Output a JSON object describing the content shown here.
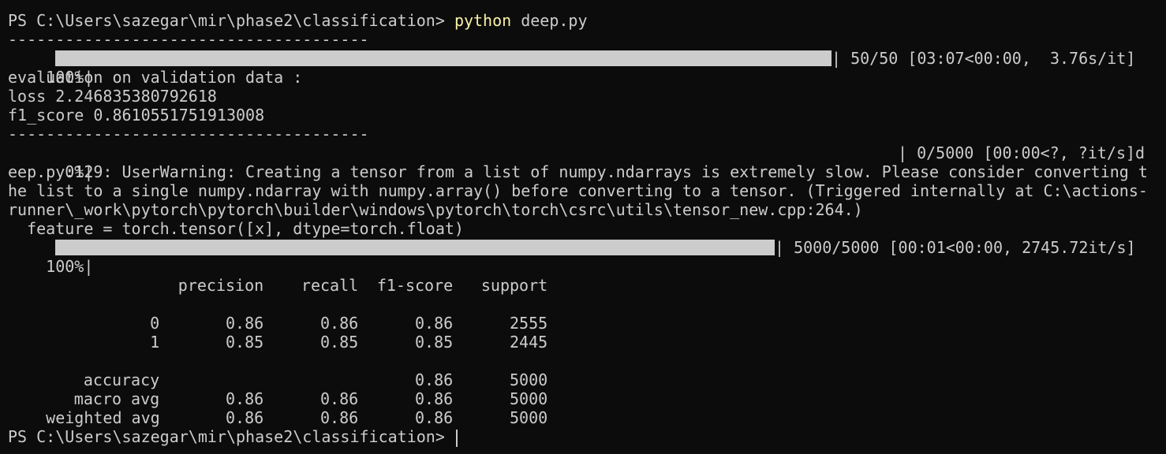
{
  "prompt1": {
    "prefix": "PS C:\\Users\\sazegar\\mir\\phase2\\classification> ",
    "command": "python",
    "args": " deep.py"
  },
  "separator1": "--------------------------------------",
  "progress1": {
    "percent_text": "100%|",
    "tail": "| 50/50 [03:07<00:00,  3.76s/it]",
    "fraction": 1.0
  },
  "eval_header": "evaluation on validation data :",
  "loss_line": "loss 2.246835380792618",
  "f1_line": "f1_score 0.8610551751913008",
  "separator2": "--------------------------------------",
  "progress2": {
    "percent_text": "  0%|",
    "tail": "| 0/5000 [00:00<?, ?it/s]d",
    "fraction": 0.0
  },
  "warning_lines": [
    "eep.py:129: UserWarning: Creating a tensor from a list of numpy.ndarrays is extremely slow. Please consider converting t",
    "he list to a single numpy.ndarray with numpy.array() before converting to a tensor. (Triggered internally at C:\\actions-",
    "runner\\_work\\pytorch\\pytorch\\builder\\windows\\pytorch\\torch\\csrc\\utils\\tensor_new.cpp:264.)",
    "  feature = torch.tensor([x], dtype=torch.float)"
  ],
  "progress3": {
    "percent_text": "100%|",
    "tail": "| 5000/5000 [00:01<00:00, 2745.72it/s]",
    "fraction": 1.0
  },
  "report": {
    "header": [
      "precision",
      "recall",
      "f1-score",
      "support"
    ],
    "rows": [
      [
        "0",
        "0.86",
        "0.86",
        "0.86",
        "2555"
      ],
      [
        "1",
        "0.85",
        "0.85",
        "0.85",
        "2445"
      ]
    ],
    "summary": [
      [
        "accuracy",
        "",
        "",
        "0.86",
        "5000"
      ],
      [
        "macro avg",
        "0.86",
        "0.86",
        "0.86",
        "5000"
      ],
      [
        "weighted avg",
        "0.86",
        "0.86",
        "0.86",
        "5000"
      ]
    ]
  },
  "prompt2": {
    "prefix": "PS C:\\Users\\sazegar\\mir\\phase2\\classification> "
  },
  "colors": {
    "background": "#0c0c0c",
    "foreground": "#cccccc",
    "command": "#f9f1a5"
  }
}
